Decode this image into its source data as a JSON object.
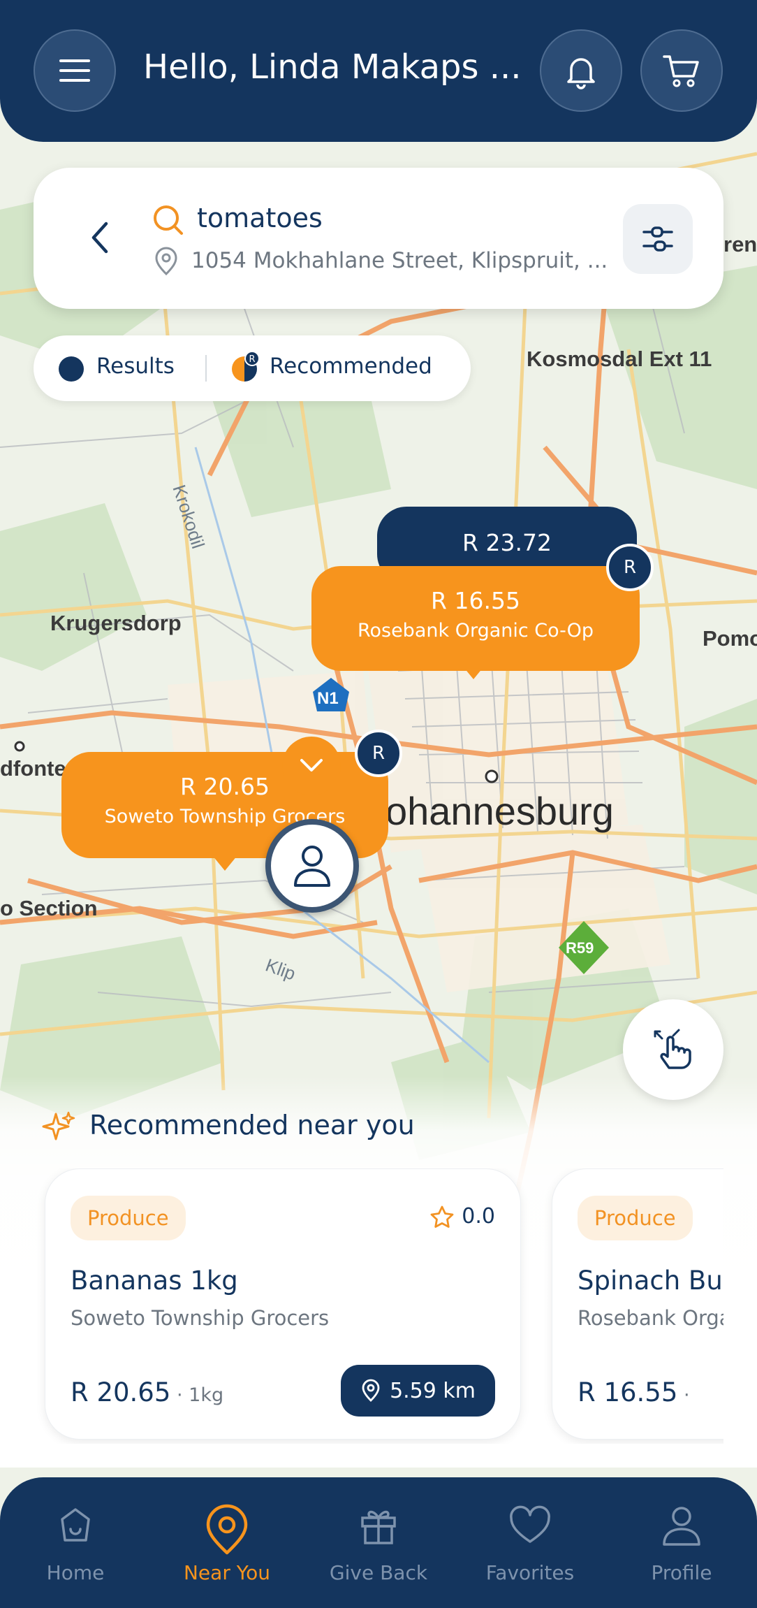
{
  "header": {
    "greeting": "Hello, Linda Makaps ...",
    "menu_icon": "menu-icon",
    "bell_icon": "bell-icon",
    "cart_icon": "cart-icon"
  },
  "search": {
    "query": "tomatoes",
    "address": "1054 Mokhahlane Street, Klipspruit, ..."
  },
  "legend": {
    "results_label": "Results",
    "recommended_label": "Recommended",
    "badge": "R"
  },
  "map": {
    "labels": {
      "kosmosdal": "Kosmosdal Ext 11",
      "krugersdorp": "Krugersdorp",
      "johannesburg": "ohannesburg",
      "roodepoort": "dfonte",
      "section": "o Section",
      "pomona": "Pomo",
      "edge_right": "ren",
      "krokodil": "Krokodil",
      "klip": "Klip",
      "n1": "N1",
      "r59": "R59"
    },
    "pins": [
      {
        "price": "R 23.72",
        "store": ""
      },
      {
        "price": "R 16.55",
        "store": "Rosebank Organic Co-Op"
      },
      {
        "price": "R 20.65",
        "store": "Soweto Township Grocers"
      }
    ],
    "recommended_badge": "R"
  },
  "recommended": {
    "title": "Recommended near you",
    "cards": [
      {
        "tag": "Produce",
        "rating": "0.0",
        "name": "Bananas 1kg",
        "store": "Soweto Township Grocers",
        "price": "R 20.65",
        "unit": " · 1kg",
        "distance": "5.59 km"
      },
      {
        "tag": "Produce",
        "rating": "",
        "name": "Spinach Bunch",
        "store": "Rosebank Organic Co-Op",
        "price": "R 16.55",
        "unit": " ·",
        "distance": ""
      }
    ]
  },
  "nav": {
    "items": [
      {
        "label": "Home",
        "icon": "home-icon"
      },
      {
        "label": "Near You",
        "icon": "location-pin-icon"
      },
      {
        "label": "Give Back",
        "icon": "gift-icon"
      },
      {
        "label": "Favorites",
        "icon": "heart-icon"
      },
      {
        "label": "Profile",
        "icon": "person-icon"
      }
    ],
    "active": "Near You"
  },
  "colors": {
    "navy": "#14355e",
    "orange": "#f7941d"
  }
}
